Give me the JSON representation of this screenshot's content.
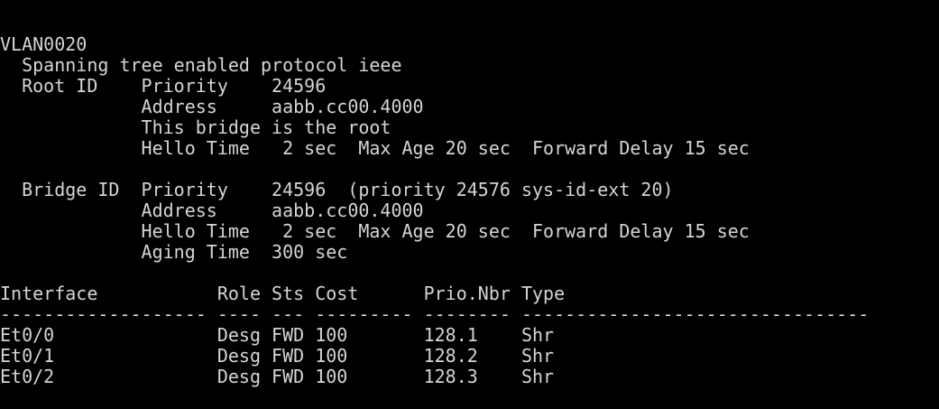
{
  "terminal": {
    "lines": [
      "VLAN0020",
      "  Spanning tree enabled protocol ieee",
      "  Root ID    Priority    24596",
      "             Address     aabb.cc00.4000",
      "             This bridge is the root",
      "             Hello Time   2 sec  Max Age 20 sec  Forward Delay 15 sec",
      "",
      "  Bridge ID  Priority    24596  (priority 24576 sys-id-ext 20)",
      "             Address     aabb.cc00.4000",
      "             Hello Time   2 sec  Max Age 20 sec  Forward Delay 15 sec",
      "             Aging Time  300 sec",
      "",
      "Interface           Role Sts Cost      Prio.Nbr Type",
      "------------------- ---- --- --------- -------- --------------------------------",
      "Et0/0               Desg FWD 100       128.1    Shr",
      "Et0/1               Desg FWD 100       128.2    Shr",
      "Et0/2               Desg FWD 100       128.3    Shr"
    ]
  },
  "colors": {
    "background": "#000000",
    "foreground": "#d3d7cf"
  }
}
